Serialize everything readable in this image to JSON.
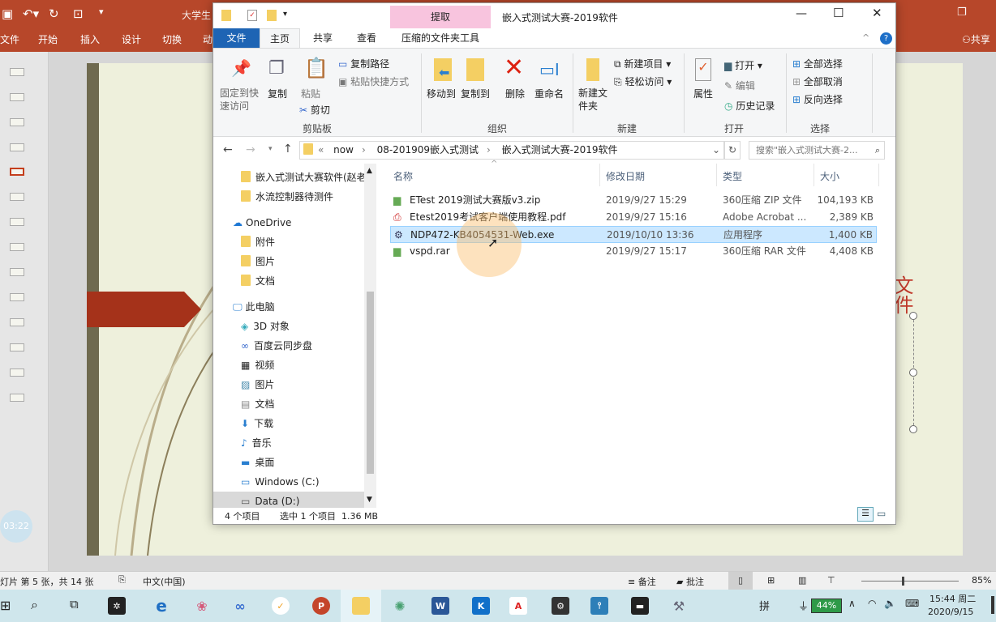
{
  "ppt": {
    "title": "大学生",
    "tabs": [
      "文件",
      "开始",
      "插入",
      "设计",
      "切换",
      "动"
    ],
    "share": "共享",
    "slide_text": "文件",
    "status": {
      "slide_info": "灯片 第 5 张，共 14 张",
      "language": "中文(中国)",
      "notes": "备注",
      "comments": "批注",
      "zoom": "85%"
    },
    "clock_overlay": "03:22"
  },
  "explorer": {
    "title": "嵌入式测试大赛-2019软件",
    "context_tab": "提取",
    "tabs": [
      "文件",
      "主页",
      "共享",
      "查看",
      "压缩的文件夹工具"
    ],
    "ribbon": {
      "clipboard": {
        "pin": "固定到快速访问",
        "copy": "复制",
        "paste": "粘贴",
        "copy_path": "复制路径",
        "paste_shortcut": "粘贴快捷方式",
        "cut": "剪切",
        "label": "剪贴板"
      },
      "organize": {
        "move_to": "移动到",
        "copy_to": "复制到",
        "delete": "删除",
        "rename": "重命名",
        "label": "组织"
      },
      "new": {
        "new_folder": "新建文件夹",
        "new_item": "新建项目",
        "easy_access": "轻松访问",
        "label": "新建"
      },
      "open": {
        "properties": "属性",
        "open": "打开",
        "edit": "编辑",
        "history": "历史记录",
        "label": "打开"
      },
      "select": {
        "select_all": "全部选择",
        "select_none": "全部取消",
        "invert": "反向选择",
        "label": "选择"
      }
    },
    "address": {
      "crumbs": [
        "now",
        "08-201909嵌入式测试",
        "嵌入式测试大赛-2019软件"
      ],
      "search_placeholder": "搜索\"嵌入式测试大赛-2..."
    },
    "nav": [
      "嵌入式测试大赛软件(赵老",
      "水流控制器待测件",
      "OneDrive",
      "附件",
      "图片",
      "文档",
      "此电脑",
      "3D 对象",
      "百度云同步盘",
      "视频",
      "图片",
      "文档",
      "下载",
      "音乐",
      "桌面",
      "Windows (C:)",
      "Data (D:)"
    ],
    "columns": [
      "名称",
      "修改日期",
      "类型",
      "大小"
    ],
    "files": [
      {
        "name": "ETest 2019测试大赛版v3.zip",
        "date": "2019/9/27 15:29",
        "type": "360压缩 ZIP 文件",
        "size": "104,193 KB",
        "icon": "archive-icon"
      },
      {
        "name": "Etest2019考试客户端使用教程.pdf",
        "date": "2019/9/27 15:16",
        "type": "Adobe Acrobat ...",
        "size": "2,389 KB",
        "icon": "pdf-icon"
      },
      {
        "name": "NDP472-KB4054531-Web.exe",
        "date": "2019/10/10 13:36",
        "type": "应用程序",
        "size": "1,400 KB",
        "icon": "installer-icon",
        "selected": true
      },
      {
        "name": "vspd.rar",
        "date": "2019/9/27 15:17",
        "type": "360压缩 RAR 文件",
        "size": "4,408 KB",
        "icon": "archive-icon"
      }
    ],
    "status": {
      "count": "4 个项目",
      "selection": "选中 1 个项目  1.36 MB"
    }
  },
  "taskbar": {
    "ime": "拼",
    "battery": "44%",
    "time": "15:44 周二",
    "date": "2020/9/15"
  }
}
